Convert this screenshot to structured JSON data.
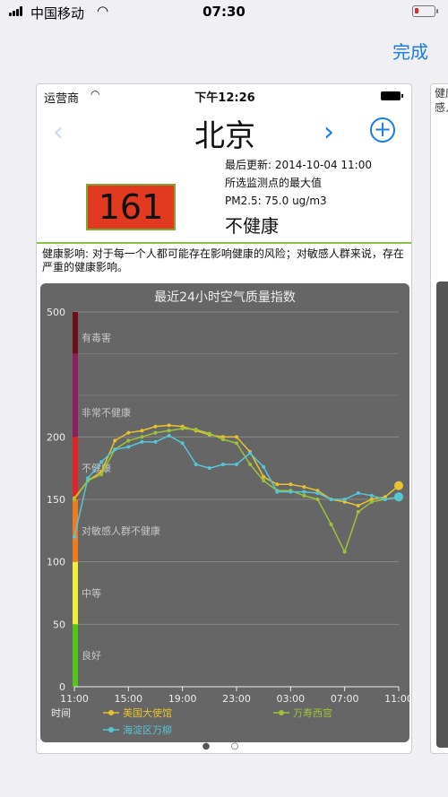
{
  "outer_status": {
    "carrier": "中国移动",
    "time": "07:30"
  },
  "done_label": "完成",
  "inner_status": {
    "carrier": "运营商",
    "time": "下午12:26"
  },
  "city": "北京",
  "aqi_value": "161",
  "meta": {
    "last_update": "最后更新: 2014-10-04 11:00",
    "source": "所选监测点的最大值",
    "pm25": "PM2.5: 75.0 ug/m3"
  },
  "level": "不健康",
  "health_impact": "健康影响: 对于每一个人都可能存在影响健康的风险；对敏感人群来说，存在严重的健康影响。",
  "peek_text": "健康\n感人",
  "colors": {
    "accent": "#1a7ce6",
    "aqi_bg": "#e23a21",
    "divider": "#8bc34a"
  },
  "chart_data": {
    "type": "line",
    "title": "最近24小时空气质量指数",
    "xlabel": "时间",
    "ylim": [
      0,
      500
    ],
    "y_ticks": [
      "0",
      "50",
      "100",
      "150",
      "200",
      "500"
    ],
    "x_tick_labels": [
      "11:00",
      "15:00",
      "19:00",
      "23:00",
      "03:00",
      "07:00",
      "11:00"
    ],
    "bands": [
      {
        "label": "良好",
        "from": 0,
        "to": 50,
        "color": "#52c41a"
      },
      {
        "label": "中等",
        "from": 50,
        "to": 100,
        "color": "#f2ef3a"
      },
      {
        "label": "对敏感人群不健康",
        "from": 100,
        "to": 150,
        "color": "#f07a1f"
      },
      {
        "label": "不健康",
        "from": 150,
        "to": 200,
        "color": "#e2232a"
      },
      {
        "label": "非常不健康",
        "from": 200,
        "to": 400,
        "color": "#8e1f5e"
      },
      {
        "label": "有毒害",
        "from": 400,
        "to": 500,
        "color": "#6b0f1a"
      }
    ],
    "x": [
      "11:00",
      "12:00",
      "13:00",
      "14:00",
      "15:00",
      "16:00",
      "17:00",
      "18:00",
      "19:00",
      "20:00",
      "21:00",
      "22:00",
      "23:00",
      "00:00",
      "01:00",
      "02:00",
      "03:00",
      "04:00",
      "05:00",
      "06:00",
      "07:00",
      "08:00",
      "09:00",
      "10:00",
      "11:00"
    ],
    "series": [
      {
        "name": "美国大使馆",
        "color": "#e8c22f",
        "values": [
          151,
          165,
          172,
          197,
          210,
          215,
          225,
          228,
          225,
          215,
          205,
          200,
          200,
          188,
          168,
          162,
          162,
          160,
          157,
          150,
          148,
          145,
          150,
          152,
          161
        ]
      },
      {
        "name": "万寿西宫",
        "color": "#9ec23a",
        "values": [
          150,
          165,
          170,
          190,
          197,
          200,
          210,
          215,
          220,
          218,
          208,
          198,
          195,
          178,
          165,
          157,
          157,
          153,
          150,
          130,
          108,
          140,
          148,
          150,
          152
        ]
      },
      {
        "name": "海淀区万柳",
        "color": "#55c6d6",
        "values": [
          120,
          167,
          180,
          190,
          192,
          196,
          196,
          203,
          195,
          178,
          175,
          178,
          178,
          187,
          176,
          156,
          156,
          156,
          155,
          150,
          150,
          155,
          153,
          150,
          152
        ]
      }
    ]
  }
}
